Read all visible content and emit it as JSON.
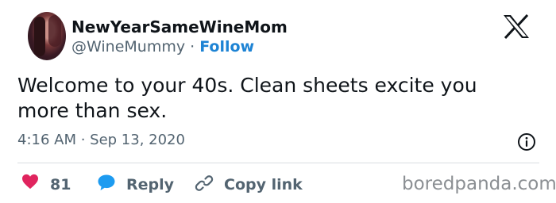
{
  "author": {
    "display_name": "NewYearSameWineMom",
    "handle": "@WineMummy",
    "separator": " · ",
    "follow_label": "Follow"
  },
  "tweet": {
    "text": "Welcome to your 40s. Clean sheets excite you more than sex.",
    "timestamp": "4:16 AM · Sep 13, 2020"
  },
  "actions": {
    "like_count": "81",
    "reply_label": "Reply",
    "copy_link_label": "Copy link"
  },
  "watermark": "boredpanda.com",
  "colors": {
    "like": "#e0245e",
    "reply": "#1d9bf0",
    "follow": "#1d83d4",
    "muted": "#536471"
  },
  "icons": {
    "platform": "x-logo-icon",
    "info": "info-icon",
    "like": "heart-icon",
    "reply": "speech-bubble-icon",
    "copy_link": "link-icon"
  }
}
